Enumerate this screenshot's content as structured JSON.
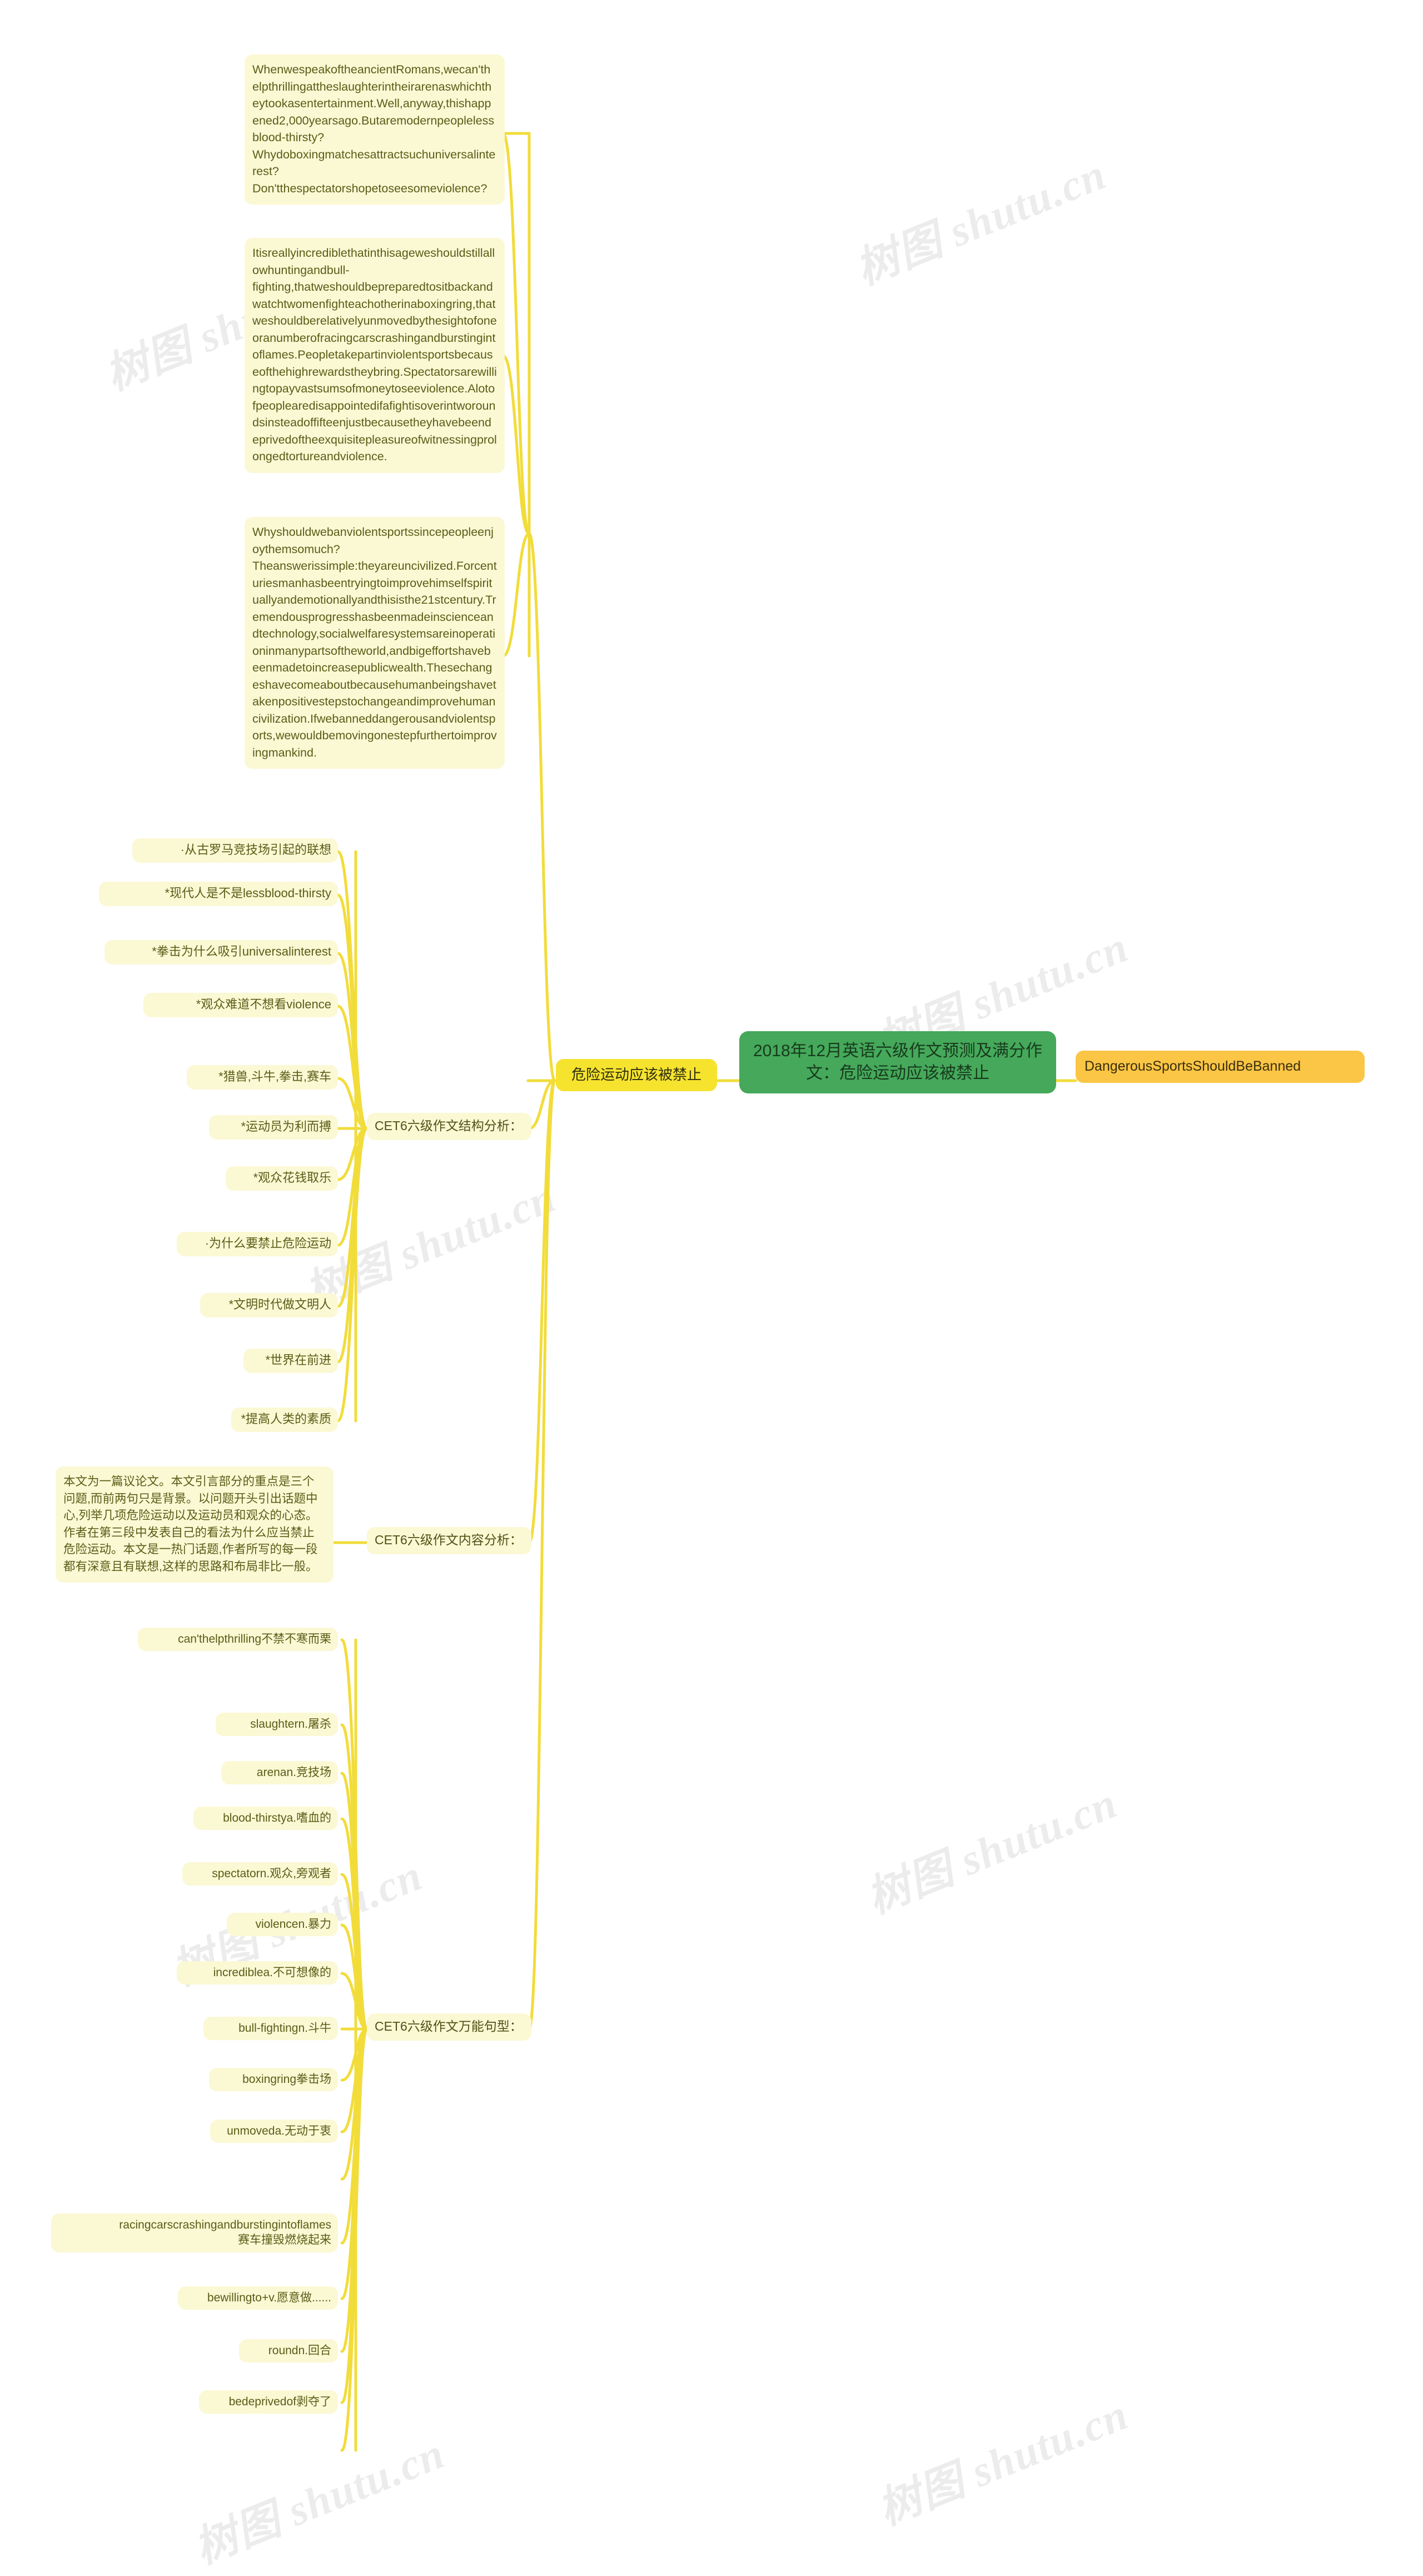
{
  "meta": {
    "watermark_text": "树图 shutu.cn",
    "colors": {
      "leaf_bg": "#fbf8d4",
      "leaf_text": "#5b5c17",
      "topic_bg": "#f6e32e",
      "root_bg": "#45a85a",
      "root_text": "#173b1d",
      "orange_bg": "#fbc545",
      "wire": "#f2dc3a",
      "page_bg": "#ffffff"
    }
  },
  "root": {
    "label": "2018年12月英语六级作文预测及满分作文：危险运动应该被禁止"
  },
  "right_branch": {
    "label": "DangerousSportsShouldBeBanned"
  },
  "topic": {
    "label": "危险运动应该被禁止"
  },
  "branches": {
    "structure": {
      "label": "CET6六级作文结构分析："
    },
    "content": {
      "label": "CET6六级作文内容分析："
    },
    "patterns": {
      "label": "CET6六级作文万能句型："
    }
  },
  "essay_paragraphs": [
    "WhenwespeakoftheancientRomans,wecan'thelpthrillingattheslaughterintheirarenaswhichtheytookasentertainment.Well,anyway,thishappened2,000yearsago.Butaremodernpeoplelessblood-thirsty?Whydoboxingmatchesattractsuchuniversalinterest?Don'tthespectatorshopetoseesomeviolence?",
    "Itisreallyincrediblethatinthisageweshouldstillallowhuntingandbull-fighting,thatweshouldbepreparedtositbackandwatchtwomenfighteachotherinaboxingring,thatweshouldberelativelyunmovedbythesightofoneoranumberofracingcarscrashingandburstingintoflames.Peopletakepartinviolentsportsbecauseofthehighrewardstheybring.Spectatorsarewillingtopayvastsumsofmoneytoseeviolence.Alotofpeoplearedisappointedifafightisoverintworoundsinsteadoffifteenjustbecausetheyhavebeendeprivedoftheexquisitepleasureofwitnessingprolongedtortureandviolence.",
    "Whyshouldwebanviolentsportssincepeopleenjoythemsomuch?Theanswerissimple:theyareuncivilized.Forcenturiesmanhasbeentryingtoimprovehimselfspirituallyandemotionallyandthisisthe21stcentury.Tremendousprogresshasbeenmadeinscienceandtechnology,socialwelfaresystemsareinoperationinmanypartsoftheworld,andbigeffortshavebeenmadetoincreasepublicwealth.Thesechangeshavecomeaboutbecausehumanbeingshavetakenpositivestepstochangeandimprovehumancivilization.Ifwebanneddangerousandviolentsports,wewouldbemovingonestepfurthertoimprovingmankind."
  ],
  "structure_items": [
    "·从古罗马竞技场引起的联想",
    "*现代人是不是lessblood-thirsty",
    "*拳击为什么吸引universalinterest",
    "*观众难道不想看violence",
    "*猎兽,斗牛,拳击,赛车",
    "*运动员为利而搏",
    "*观众花钱取乐",
    "·为什么要禁止危险运动",
    "*文明时代做文明人",
    "*世界在前进",
    "*提高人类的素质"
  ],
  "content_analysis": "本文为一篇议论文。本文引言部分的重点是三个问题,而前两句只是背景。以问题开头引出话题中心,列举几项危险运动以及运动员和观众的心态。作者在第三段中发表自己的看法为什么应当禁止危险运动。本文是一热门话题,作者所写的每一段都有深意且有联想,这样的思路和布局非比一般。",
  "vocabulary_items": [
    "can'thelpthrilling不禁不寒而栗",
    "slaughtern.屠杀",
    "arenan.竞技场",
    "blood-thirstya.嗜血的",
    "spectatorn.观众,旁观者",
    "violencen.暴力",
    "incrediblea.不可想像的",
    "bull-fightingn.斗牛",
    "boxingring拳击场",
    "unmoveda.无动于衷",
    "racingcarscrashingandburstingintoflames\n赛车撞毁燃烧起来",
    "bewillingto+v.愿意做......",
    "roundn.回合",
    "bedeprivedof剥夺了"
  ]
}
